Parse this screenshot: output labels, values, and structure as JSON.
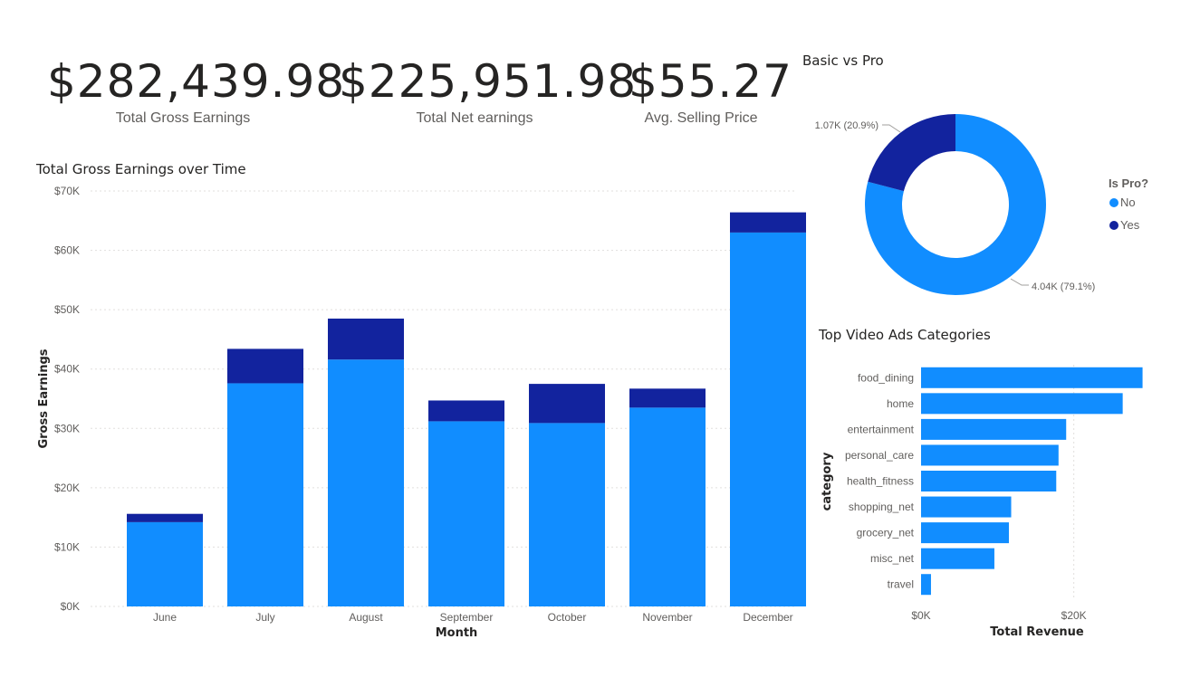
{
  "colors": {
    "no": "#118DFF",
    "yes": "#12239E",
    "grid": "#e1dfdd"
  },
  "kpis": [
    {
      "value": "$282,439.98",
      "label": "Total Gross Earnings"
    },
    {
      "value": "$225,951.98",
      "label": "Total Net earnings"
    },
    {
      "value": "$55.27",
      "label": "Avg. Selling Price"
    }
  ],
  "chart_data": [
    {
      "type": "bar",
      "stacked": true,
      "title": "Total Gross Earnings over Time",
      "xlabel": "Month",
      "ylabel": "Gross Earnings",
      "categories": [
        "June",
        "July",
        "August",
        "September",
        "October",
        "November",
        "December"
      ],
      "series": [
        {
          "name": "No",
          "values": [
            14200,
            37600,
            41600,
            31200,
            30900,
            33500,
            63000
          ]
        },
        {
          "name": "Yes",
          "values": [
            1400,
            5800,
            6900,
            3500,
            6600,
            3200,
            3400
          ]
        }
      ],
      "ylim": [
        0,
        70000
      ],
      "yticks": [
        "$0K",
        "$10K",
        "$20K",
        "$30K",
        "$40K",
        "$50K",
        "$60K",
        "$70K"
      ],
      "grid": true
    },
    {
      "type": "pie",
      "donut": true,
      "title": "Basic vs Pro",
      "legend_title": "Is Pro?",
      "categories": [
        "No",
        "Yes"
      ],
      "values": [
        4040,
        1070
      ],
      "data_labels": [
        "4.04K (79.1%)",
        "1.07K (20.9%)"
      ],
      "legend": "right"
    },
    {
      "type": "bar",
      "orientation": "horizontal",
      "title": "Top Video Ads Categories",
      "xlabel": "Total Revenue",
      "ylabel": "category",
      "categories": [
        "food_dining",
        "home",
        "entertainment",
        "personal_care",
        "health_fitness",
        "shopping_net",
        "grocery_net",
        "misc_net",
        "travel"
      ],
      "values": [
        29000,
        26400,
        19000,
        18000,
        17700,
        11800,
        11500,
        9600,
        1300
      ],
      "xlim": [
        0,
        30000
      ],
      "xticks": [
        "$0K",
        "$20K"
      ],
      "grid": true
    }
  ]
}
